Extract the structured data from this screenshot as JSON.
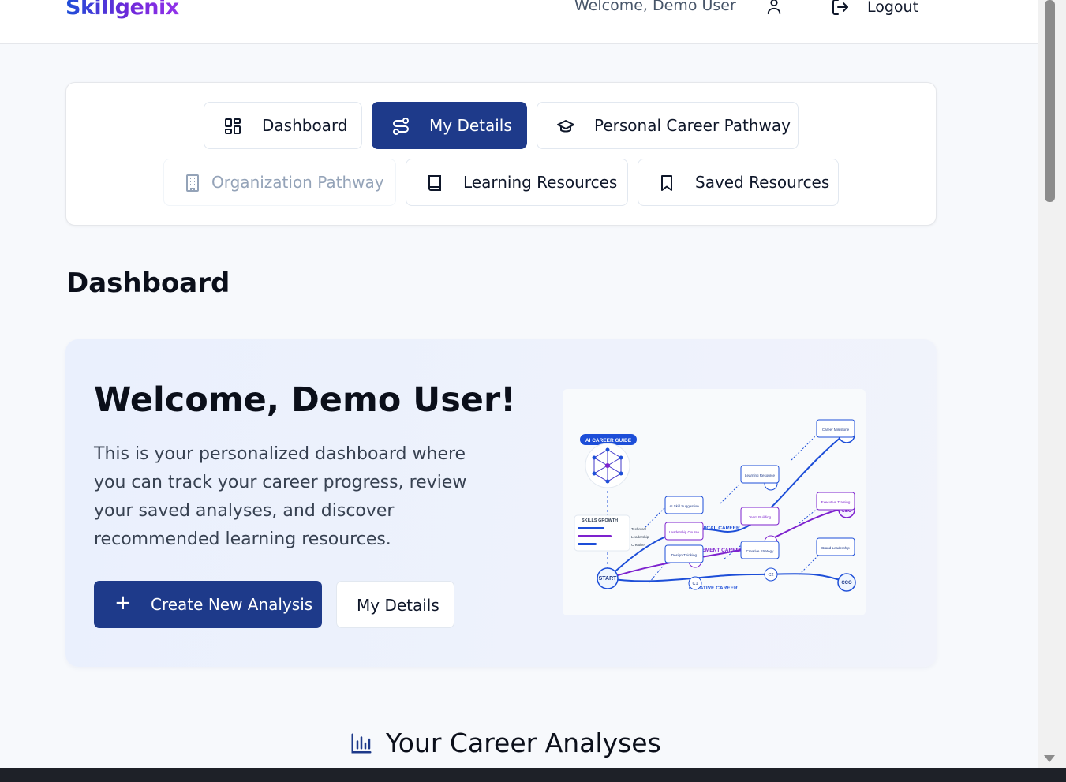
{
  "header": {
    "brand": "Skillgenix",
    "welcome": "Welcome, Demo User",
    "logout_label": "Logout",
    "user_icon": "user-icon",
    "logout_icon": "logout-icon"
  },
  "nav": {
    "tabs": [
      {
        "label": "Dashboard",
        "icon": "grid-icon",
        "state": "default"
      },
      {
        "label": "My Details",
        "icon": "route-icon",
        "state": "active"
      },
      {
        "label": "Personal Career Pathway",
        "icon": "graduation-cap-icon",
        "state": "default"
      },
      {
        "label": "Organization Pathway",
        "icon": "building-icon",
        "state": "disabled"
      },
      {
        "label": "Learning Resources",
        "icon": "book-icon",
        "state": "default"
      },
      {
        "label": "Saved Resources",
        "icon": "bookmark-icon",
        "state": "default"
      }
    ]
  },
  "page": {
    "title": "Dashboard"
  },
  "hero": {
    "title": "Welcome, Demo User!",
    "text": "This is your personalized dashboard where you can track your career progress, review your saved analyses, and discover recommended learning resources.",
    "primary_button": "Create New Analysis",
    "secondary_button": "My Details",
    "illustration": {
      "badge": "AI CAREER GUIDE",
      "skills_title": "SKILLS GROWTH",
      "skills": [
        "Technical",
        "Leadership",
        "Creative"
      ],
      "paths": [
        "TECHNICAL CAREER",
        "MANAGEMENT CAREER",
        "CREATIVE CAREER"
      ],
      "nodes": [
        "START",
        "C1",
        "C2",
        "CCO",
        "CEO"
      ],
      "cards": [
        "Career Milestone",
        "Learning Resource",
        "AI Skill Suggestion",
        "Team Building",
        "Leadership Course",
        "Executive Training",
        "Design Thinking",
        "Creative Strategy",
        "Brand Leadership"
      ]
    }
  },
  "analyses": {
    "title": "Your Career Analyses",
    "icon": "bar-chart-icon"
  },
  "colors": {
    "primary": "#1e3a8a",
    "brand_start": "#1d4ed8",
    "brand_end": "#9333ea",
    "purple": "#7e22ce"
  }
}
